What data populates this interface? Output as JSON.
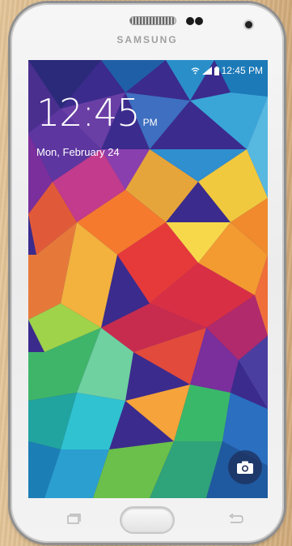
{
  "device": {
    "brand": "SAMSUNG"
  },
  "statusbar": {
    "time": "12:45 PM",
    "icons": [
      "wifi-icon",
      "signal-icon",
      "battery-icon"
    ]
  },
  "lockscreen": {
    "time": "12:45",
    "ampm": "PM",
    "date": "Mon, February 24",
    "camera_shortcut_icon": "camera-icon"
  },
  "hardware_keys": [
    "recent-apps-icon",
    "home-button",
    "back-icon"
  ],
  "colors": {
    "wallpaper_accent": "#e63a3a",
    "text": "#ffffff"
  }
}
